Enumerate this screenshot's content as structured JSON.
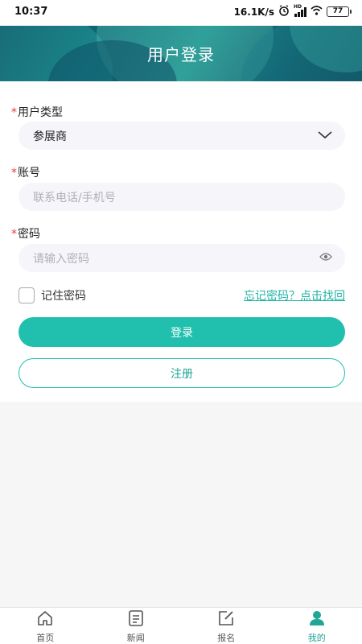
{
  "status_bar": {
    "time": "10:37",
    "speed": "16.1K/s",
    "hd": "HD",
    "battery": "77"
  },
  "header": {
    "title": "用户登录"
  },
  "form": {
    "required_mark": "*",
    "user_type_label": "用户类型",
    "user_type_value": "参展商",
    "account_label": "账号",
    "account_placeholder": "联系电话/手机号",
    "password_label": "密码",
    "password_placeholder": "请输入密码",
    "remember_label": "记住密码",
    "forgot_link": "忘记密码？点击找回",
    "login_button": "登录",
    "register_button": "注册"
  },
  "tabbar": {
    "items": [
      {
        "label": "首页",
        "icon": "home-icon",
        "active": false
      },
      {
        "label": "新闻",
        "icon": "news-icon",
        "active": false
      },
      {
        "label": "报名",
        "icon": "signup-edit-icon",
        "active": false
      },
      {
        "label": "我的",
        "icon": "user-icon",
        "active": true
      }
    ]
  },
  "colors": {
    "accent": "#20bfae",
    "required": "#e23b3b",
    "link": "#20b3a4"
  }
}
